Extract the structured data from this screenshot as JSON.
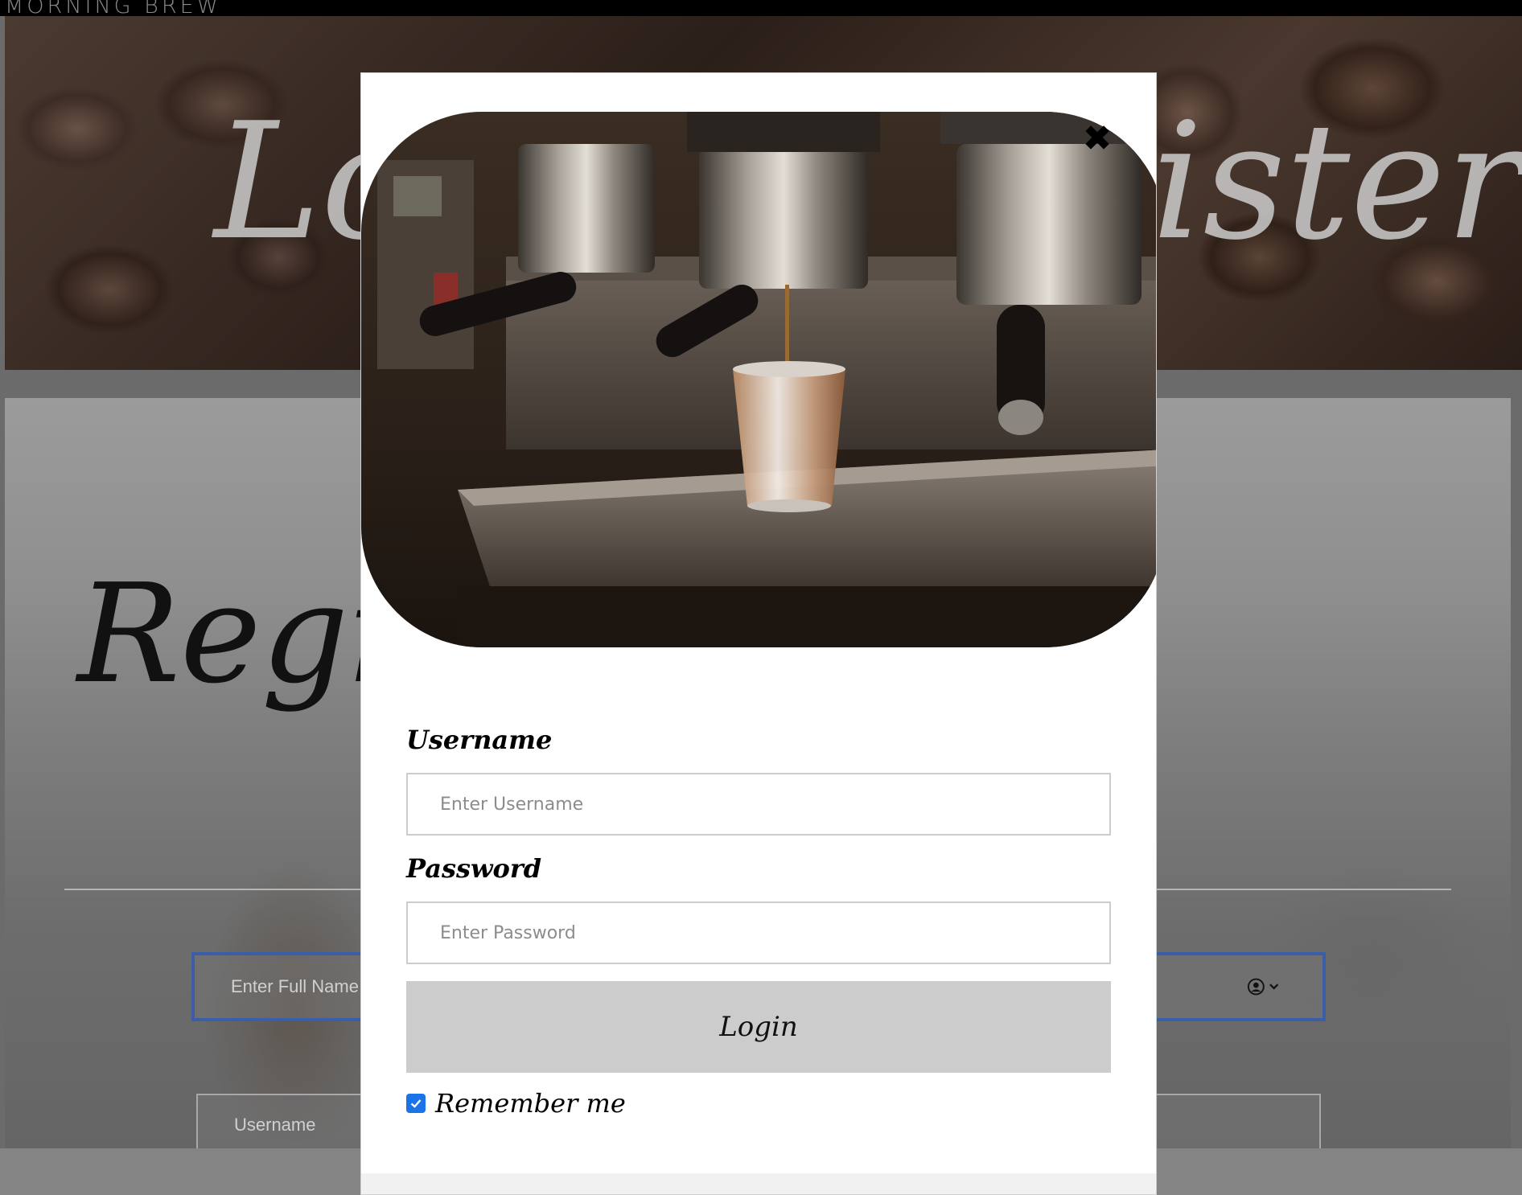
{
  "brand": "MORNING BREW",
  "hero": {
    "title": "Login / Register"
  },
  "register": {
    "title": "Register",
    "fullname_placeholder": "Enter Full Name",
    "username_placeholder": "Username"
  },
  "modal": {
    "username_label": "Username",
    "username_placeholder": "Enter Username",
    "password_label": "Password",
    "password_placeholder": "Enter Password",
    "login_label": "Login",
    "remember_label": "Remember me",
    "remember_checked": true,
    "close_icon": "close-icon"
  },
  "colors": {
    "accent": "#1a73e8",
    "login_button_bg": "#cccccc",
    "focused_border": "#3b5ea8"
  }
}
